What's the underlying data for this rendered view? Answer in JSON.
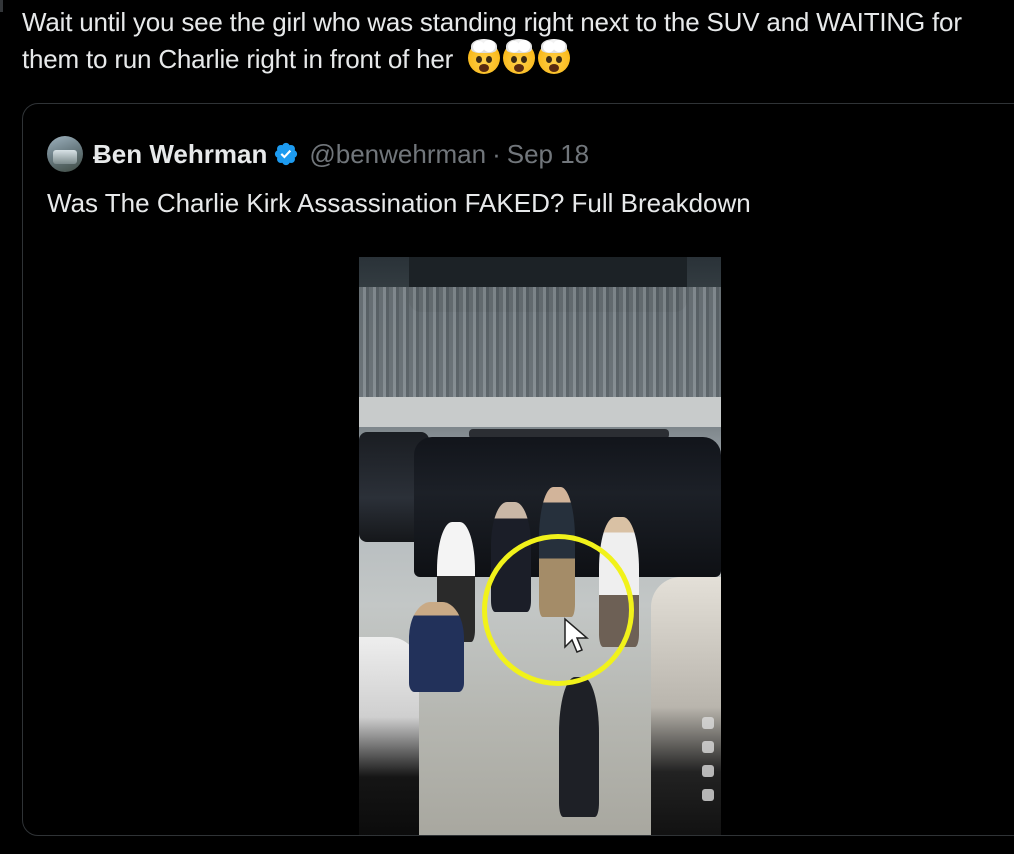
{
  "tweet": {
    "text": "Wait until you see the girl who was standing right next to the SUV and WAITING for them to run Charlie right in front of her",
    "emojis": [
      "exploding-head",
      "exploding-head",
      "exploding-head"
    ]
  },
  "quoted_tweet": {
    "author_name": "Ƀen Wehrman",
    "verified": true,
    "handle": "@benwehrman",
    "separator": "·",
    "date": "Sep 18",
    "text": "Was The Charlie Kirk Assassination FAKED? Full Breakdown",
    "media": {
      "type": "video",
      "icon": "video-thumbnail",
      "overlay_annotation": "yellow-circle"
    }
  },
  "colors": {
    "background": "#000000",
    "text_primary": "#e7e9ea",
    "text_secondary": "#71767b",
    "border": "#2f3336",
    "verified_blue": "#1d9bf0",
    "annotation_yellow": "#f1f21a"
  }
}
